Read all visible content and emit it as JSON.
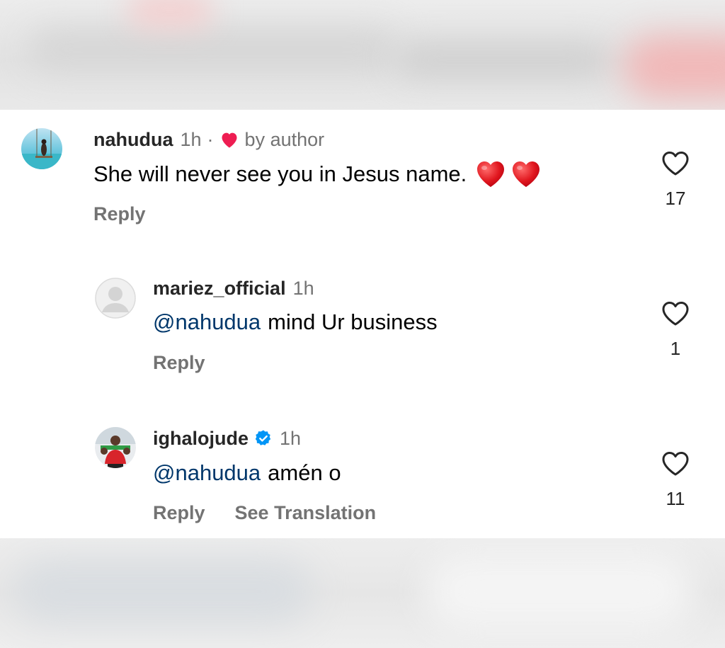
{
  "comments": [
    {
      "username": "nahudua",
      "time": "1h",
      "separator": "·",
      "liked_by": "by author",
      "mention": "",
      "text": "She will never see you in Jesus name.",
      "emoji": [
        "red-heart",
        "red-heart"
      ],
      "reply_label": "Reply",
      "likes": "17",
      "verified": false
    },
    {
      "username": "mariez_official",
      "time": "1h",
      "mention": "@nahudua",
      "text": "mind Ur business",
      "reply_label": "Reply",
      "likes": "1",
      "verified": false
    },
    {
      "username": "ighalojude",
      "time": "1h",
      "mention": "@nahudua",
      "text": "amén o",
      "reply_label": "Reply",
      "see_translation": "See Translation",
      "likes": "11",
      "verified": true
    }
  ],
  "colors": {
    "heart_red": "#ee1d52",
    "mention_blue": "#00376b",
    "verified_blue": "#0095f6",
    "secondary_text": "#737373"
  }
}
